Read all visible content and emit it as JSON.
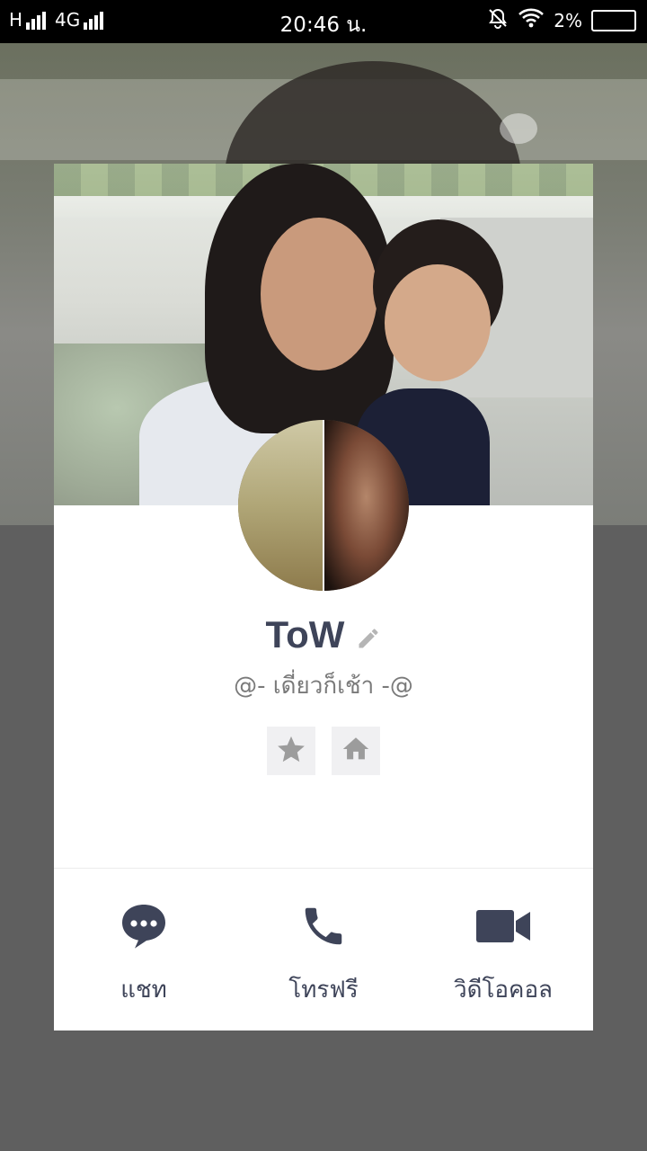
{
  "status_bar": {
    "network_h": "H",
    "network_4g": "4G",
    "time": "20:46 น.",
    "battery": "2%"
  },
  "profile": {
    "name": "ToW",
    "status_message": "@- เดี่ยวก็เช้า -@"
  },
  "actions": [
    {
      "label": "แชท",
      "icon": "chat-bubble-icon"
    },
    {
      "label": "โทรฟรี",
      "icon": "phone-icon"
    },
    {
      "label": "วิดีโอคอล",
      "icon": "video-camera-icon"
    }
  ],
  "quick_icons": [
    "star-icon",
    "home-icon"
  ],
  "colors": {
    "accent": "#3e4459",
    "icon_box": "#f0f0f2",
    "overlay": "#5e5e5e"
  }
}
